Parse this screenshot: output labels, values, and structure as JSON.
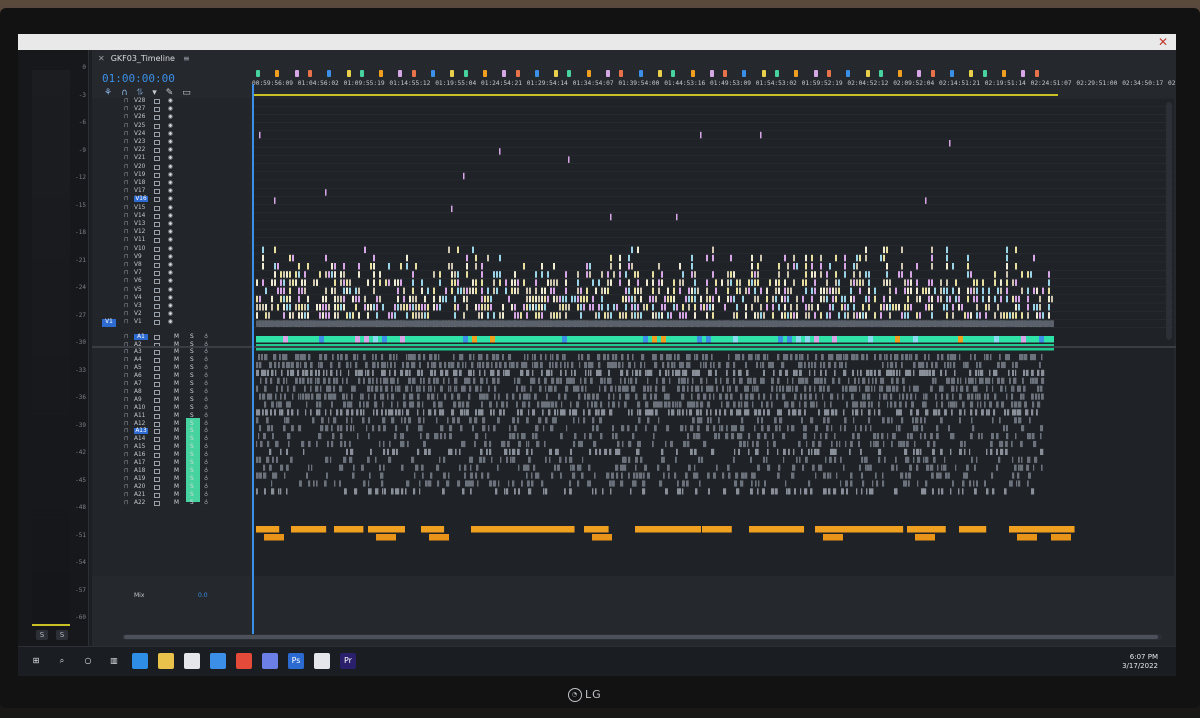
{
  "sequence": {
    "tab_title": "GKF03_Timeline",
    "timecode": "01:00:00:00",
    "ruler_labels": [
      "00:59:56:09",
      "01:04:56:02",
      "01:09:55:19",
      "01:14:55:12",
      "01:19:55:04",
      "01:24:54:21",
      "01:29:54:14",
      "01:34:54:07",
      "01:39:54:00",
      "01:44:53:16",
      "01:49:53:09",
      "01:54:53:02",
      "01:59:52:19",
      "02:04:52:12",
      "02:09:52:04",
      "02:14:51:21",
      "02:19:51:14",
      "02:24:51:07",
      "02:29:51:00",
      "02:34:50:17",
      "02:"
    ]
  },
  "video_tracks": [
    "V28",
    "V27",
    "V26",
    "V25",
    "V24",
    "V23",
    "V22",
    "V21",
    "V20",
    "V19",
    "V18",
    "V17",
    "V16",
    "V15",
    "V14",
    "V13",
    "V12",
    "V11",
    "V10",
    "V9",
    "V8",
    "V7",
    "V6",
    "V5",
    "V4",
    "V3",
    "V2",
    "V1"
  ],
  "audio_tracks": [
    "A1",
    "A2",
    "A3",
    "A4",
    "A5",
    "A6",
    "A7",
    "A8",
    "A9",
    "A10",
    "A11",
    "A12",
    "A13",
    "A14",
    "A15",
    "A16",
    "A17",
    "A18",
    "A19",
    "A20",
    "A21",
    "A22"
  ],
  "selected_tracks": {
    "video": "V16",
    "audio": "A13",
    "source_patch": "V1"
  },
  "mix": {
    "label": "Mix",
    "value": "0.0"
  },
  "meter": {
    "scale": [
      "0",
      "-3",
      "-6",
      "-9",
      "-12",
      "-15",
      "-18",
      "-21",
      "-24",
      "-27",
      "-30",
      "-33",
      "-36",
      "-39",
      "-42",
      "-45",
      "-48",
      "-51",
      "-54",
      "-57",
      "-60"
    ],
    "buttons": [
      "S",
      "S"
    ]
  },
  "taskbar": {
    "time": "6:07 PM",
    "date": "3/17/2022",
    "apps": [
      "windows-icon",
      "search-icon",
      "cortana-icon",
      "task-view-icon",
      "edge-icon",
      "file-explorer-icon",
      "notepad-icon",
      "mail-icon",
      "chrome-icon",
      "discord-icon",
      "photoshop-icon",
      "slack-icon",
      "premiere-icon"
    ],
    "app_labels": {
      "photoshop": "Ps",
      "premiere": "Pr"
    }
  },
  "monitor_brand": "LG",
  "colors": {
    "accent": "#3b8fe6",
    "audio_green": "#46d39f",
    "video_pink": "#d7a6e6",
    "audio_orange": "#f0a020"
  }
}
